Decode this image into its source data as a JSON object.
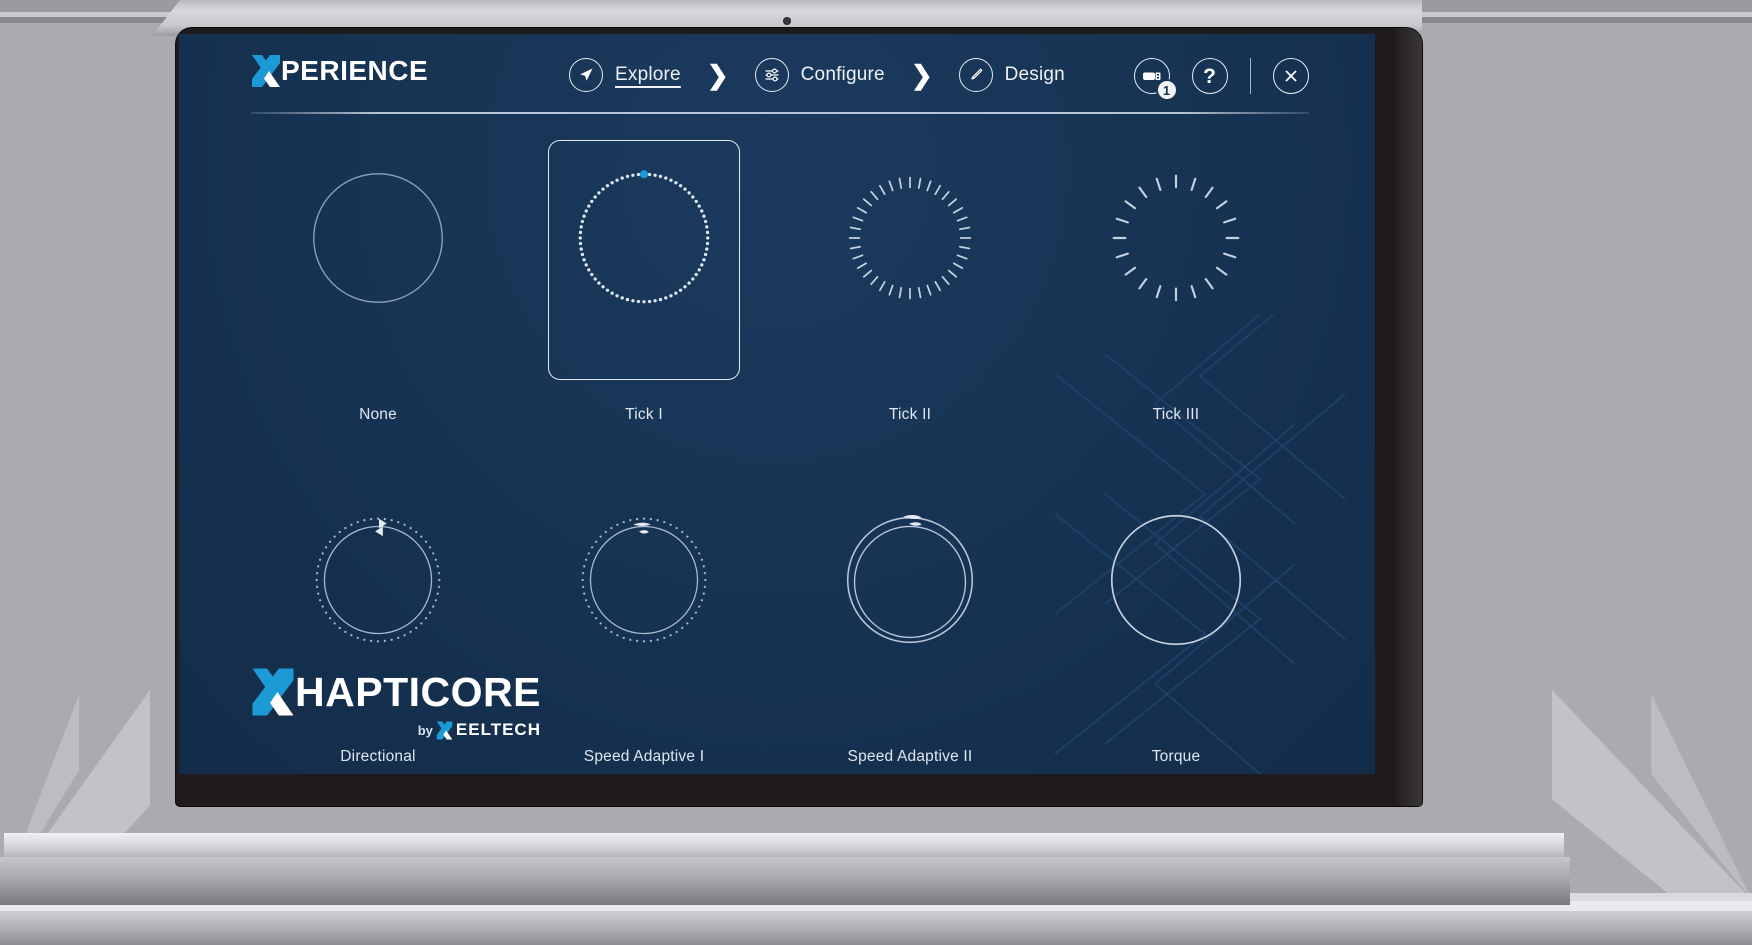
{
  "app": {
    "brand_x": "X",
    "brand_name": "PERIENCE"
  },
  "nav": {
    "separator": "❯",
    "items": [
      {
        "label": "Explore",
        "icon": "navigation-arrow-icon",
        "active": true
      },
      {
        "label": "Configure",
        "icon": "sliders-icon",
        "active": false
      },
      {
        "label": "Design",
        "icon": "paintbrush-icon",
        "active": false
      }
    ]
  },
  "top_right": {
    "device": {
      "icon": "usb-device-icon",
      "badge": "1"
    },
    "help": {
      "icon": "question-mark-icon",
      "label": "?"
    },
    "close": {
      "icon": "close-x-icon"
    }
  },
  "patterns": {
    "row1": [
      {
        "label": "None",
        "dial": "plain-circle",
        "selected": false
      },
      {
        "label": "Tick I",
        "dial": "fine-dots",
        "selected": true
      },
      {
        "label": "Tick II",
        "dial": "medium-ticks",
        "selected": false
      },
      {
        "label": "Tick III",
        "dial": "coarse-ticks",
        "selected": false
      }
    ],
    "row2": [
      {
        "label": "Directional",
        "dial": "directional-arrows",
        "selected": false
      },
      {
        "label": "Speed Adaptive I",
        "dial": "speed-adaptive-1",
        "selected": false
      },
      {
        "label": "Speed Adaptive II",
        "dial": "speed-adaptive-2",
        "selected": false
      },
      {
        "label": "Torque",
        "dial": "thick-circle",
        "selected": false
      }
    ]
  },
  "footer_logo": {
    "mark": "X",
    "name": "HAPTICORE",
    "by": "by",
    "company_mark": "X",
    "company": "EELTECH"
  },
  "colors": {
    "accent_blue": "#1b9ad6",
    "screen_bg": "#163152",
    "text_primary": "#eef2f7",
    "bezel": "#1f1b1d"
  }
}
